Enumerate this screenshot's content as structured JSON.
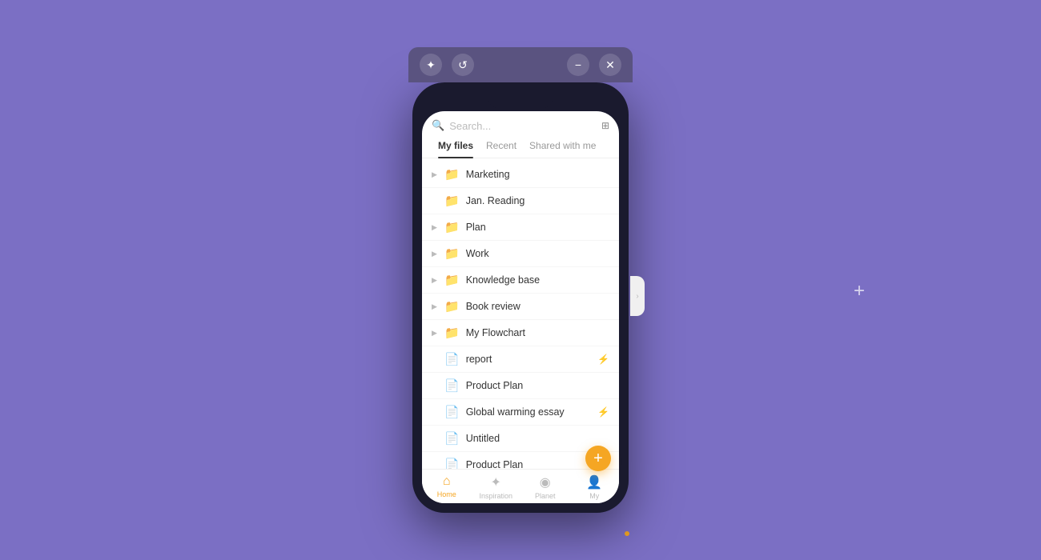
{
  "background": {
    "color": "#7b6fc4"
  },
  "toolbar": {
    "star_icon": "✦",
    "history_icon": "↺",
    "minimize_icon": "−",
    "close_icon": "✕"
  },
  "search": {
    "placeholder": "Search...",
    "icon": "🔍",
    "grid_icon": "⊞"
  },
  "tabs": [
    {
      "label": "My files",
      "active": true
    },
    {
      "label": "Recent",
      "active": false
    },
    {
      "label": "Shared with me",
      "active": false
    }
  ],
  "files": [
    {
      "type": "folder",
      "name": "Marketing",
      "chevron": true,
      "badge": ""
    },
    {
      "type": "folder",
      "name": "Jan. Reading",
      "chevron": false,
      "badge": ""
    },
    {
      "type": "folder",
      "name": "Plan",
      "chevron": true,
      "badge": ""
    },
    {
      "type": "folder",
      "name": "Work",
      "chevron": true,
      "badge": ""
    },
    {
      "type": "folder",
      "name": "Knowledge base",
      "chevron": true,
      "badge": ""
    },
    {
      "type": "folder",
      "name": "Book review",
      "chevron": true,
      "badge": ""
    },
    {
      "type": "folder",
      "name": "My Flowchart",
      "chevron": true,
      "badge": ""
    },
    {
      "type": "doc",
      "name": "report",
      "chevron": false,
      "badge": "⚡"
    },
    {
      "type": "doc",
      "name": "Product Plan",
      "chevron": false,
      "badge": ""
    },
    {
      "type": "doc",
      "name": "Global warming essay",
      "chevron": false,
      "badge": "⚡"
    },
    {
      "type": "doc-blue",
      "name": "Untitled",
      "chevron": false,
      "badge": ""
    },
    {
      "type": "doc",
      "name": "Product Plan",
      "chevron": false,
      "badge": ""
    }
  ],
  "nav": [
    {
      "label": "Home",
      "icon": "⌂",
      "active": true
    },
    {
      "label": "Inspiration",
      "icon": "✦",
      "active": false
    },
    {
      "label": "Planet",
      "icon": "◉",
      "active": false
    },
    {
      "label": "My",
      "icon": "👤",
      "active": false
    }
  ],
  "fab": {
    "icon": "+"
  }
}
